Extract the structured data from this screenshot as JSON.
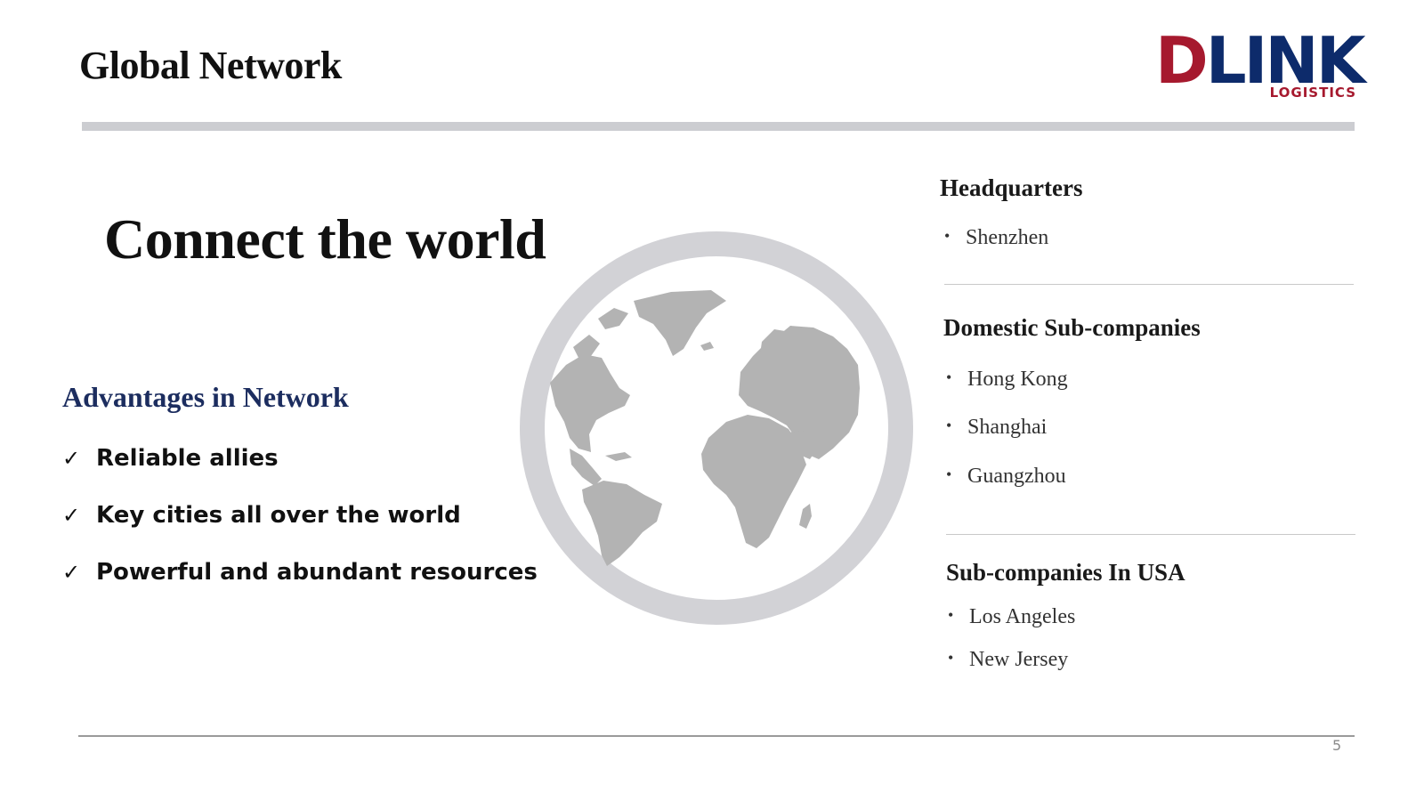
{
  "slide": {
    "title": "Global Network",
    "page_number": "5"
  },
  "logo": {
    "main_first": "D",
    "main_rest": "LINK",
    "sub": "LOGISTICS",
    "colors": {
      "red": "#a6192e",
      "navy": "#0d2b6b"
    }
  },
  "headline": "Connect the world",
  "advantages": {
    "heading": "Advantages in Network",
    "check_icon": "✓",
    "items": [
      "Reliable allies",
      "Key cities all over the world",
      "Powerful and abundant resources"
    ]
  },
  "globe": {
    "icon": "globe-icon",
    "color": "#b3b3b3",
    "ring_color": "#d2d2d6"
  },
  "headquarters": {
    "heading": "Headquarters",
    "items": [
      "Shenzhen"
    ]
  },
  "domestic": {
    "heading": "Domestic Sub-companies",
    "items": [
      "Hong Kong",
      "Shanghai",
      "Guangzhou"
    ]
  },
  "usa": {
    "heading": "Sub-companies In USA",
    "items": [
      "Los Angeles",
      "New Jersey"
    ]
  },
  "bullet_glyph": "•"
}
